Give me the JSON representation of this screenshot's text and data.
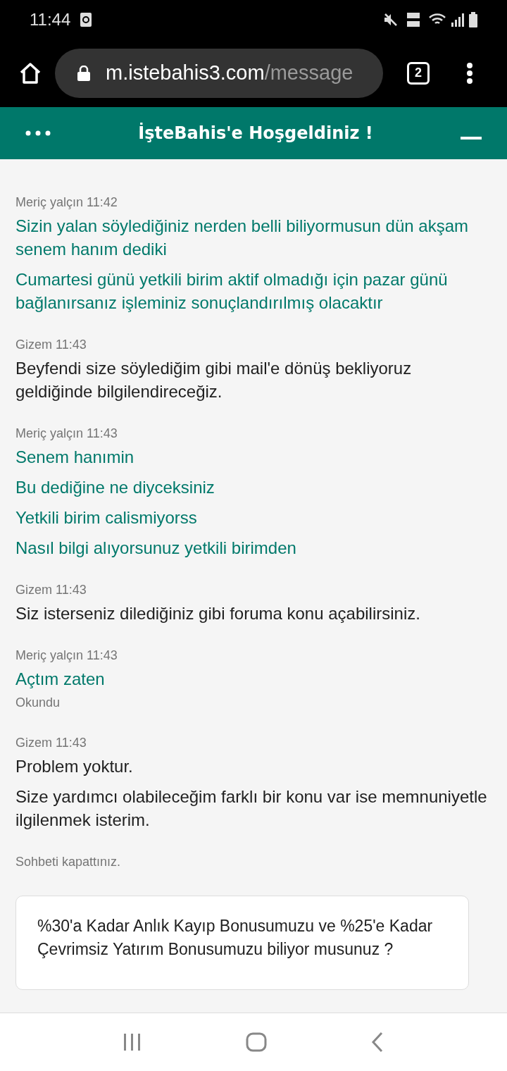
{
  "status_bar": {
    "time": "11:44"
  },
  "browser": {
    "url_host": "m.istebahis3.com",
    "url_path": "/message",
    "tab_count": "2"
  },
  "header": {
    "title": "İşteBahis'e Hoşgeldiniz !"
  },
  "messages": [
    {
      "kind": "user",
      "sender": "Meriç yalçın",
      "time": "11:42",
      "lines": [
        "Sizin yalan söylediğiniz nerden belli biliyormusun dün akşam senem hanım dediki",
        "Cumartesi günü yetkili birim aktif olmadığı için pazar günü bağlanırsanız işleminiz sonuçlandırılmış olacaktır"
      ]
    },
    {
      "kind": "agent",
      "sender": "Gizem",
      "time": "11:43",
      "lines": [
        "Beyfendi size söylediğim gibi mail'e dönüş bekliyoruz geldiğinde bilgilendireceğiz."
      ]
    },
    {
      "kind": "user",
      "sender": "Meriç yalçın",
      "time": "11:43",
      "lines": [
        "Senem hanımin",
        "Bu dediğine ne diyceksiniz",
        "Yetkili birim calismiyorss",
        "Nasıl bilgi alıyorsunuz yetkili birimden"
      ]
    },
    {
      "kind": "agent",
      "sender": "Gizem",
      "time": "11:43",
      "lines": [
        "Siz isterseniz dilediğiniz gibi foruma konu açabilirsiniz."
      ]
    },
    {
      "kind": "user",
      "sender": "Meriç yalçın",
      "time": "11:43",
      "lines": [
        "Açtım zaten"
      ],
      "receipt": "Okundu"
    },
    {
      "kind": "agent",
      "sender": "Gizem",
      "time": "11:43",
      "lines": [
        "Problem yoktur.",
        "Size yardımcı olabileceğim farklı bir konu var ise memnuniyetle ilgilenmek isterim."
      ]
    }
  ],
  "system_note": "Sohbeti kapattınız.",
  "promo_card": {
    "text": "%30'a Kadar Anlık Kayıp Bonusumuzu ve %25'e Kadar Çevrimsiz Yatırım Bonusumuzu biliyor musunuz ?"
  }
}
